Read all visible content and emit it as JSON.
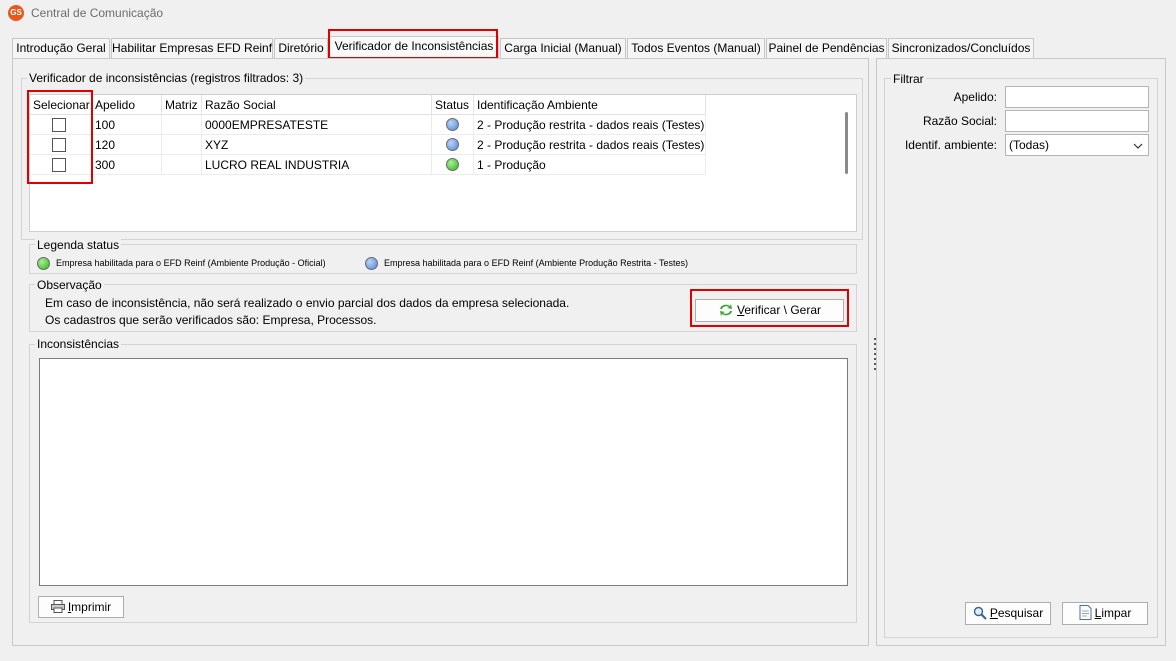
{
  "window": {
    "title": "Central de Comunicação",
    "icon_text": "GS"
  },
  "tabs": [
    {
      "label": "Introdução Geral"
    },
    {
      "label": "Habilitar Empresas EFD Reinf"
    },
    {
      "label": "Diretório"
    },
    {
      "label": "Verificador de Inconsistências"
    },
    {
      "label": "Carga Inicial (Manual)"
    },
    {
      "label": "Todos Eventos (Manual)"
    },
    {
      "label": "Painel de Pendências"
    },
    {
      "label": "Sincronizados/Concluídos"
    }
  ],
  "verificador": {
    "group_title": "Verificador de inconsistências (registros filtrados: 3)",
    "columns": [
      "Selecionar",
      "Apelido",
      "Matriz",
      "Razão Social",
      "Status",
      "Identificação Ambiente"
    ],
    "rows": [
      {
        "apelido": "100",
        "matriz": "",
        "razao": "0000EMPRESATESTE",
        "status": "blue",
        "ambiente": "2 - Produção restrita - dados reais (Testes)"
      },
      {
        "apelido": "120",
        "matriz": "",
        "razao": "XYZ",
        "status": "blue",
        "ambiente": "2 - Produção restrita - dados reais (Testes)"
      },
      {
        "apelido": "300",
        "matriz": "",
        "razao": "LUCRO REAL INDUSTRIA",
        "status": "green",
        "ambiente": "1 - Produção"
      }
    ]
  },
  "legenda": {
    "title": "Legenda status",
    "green_text": "Empresa habilitada para o EFD Reinf (Ambiente Produção - Oficial)",
    "blue_text": "Empresa habilitada para o EFD Reinf (Ambiente Produção Restrita - Testes)"
  },
  "observacao": {
    "title": "Observação",
    "line1": "Em caso de inconsistência, não será realizado o envio parcial dos dados da empresa selecionada.",
    "line2": "Os cadastros que serão verificados são: Empresa, Processos.",
    "button_rest": "erificar \\ Gerar",
    "button_access_key": "V"
  },
  "inconsistencias": {
    "title": "Inconsistências",
    "print_access_key": "I",
    "print_rest": "mprimir"
  },
  "filtrar": {
    "title": "Filtrar",
    "apelido_label": "Apelido:",
    "apelido_value": "",
    "razao_label": "Razão Social:",
    "razao_value": "",
    "ambiente_label": "Identif. ambiente:",
    "ambiente_value": "(Todas)",
    "search_access_key": "P",
    "search_rest": "esquisar",
    "clear_access_key": "L",
    "clear_rest": "impar"
  },
  "colors": {
    "highlight": "#e00000",
    "status_green": "#2fb51d",
    "status_blue": "#4f86d6"
  }
}
